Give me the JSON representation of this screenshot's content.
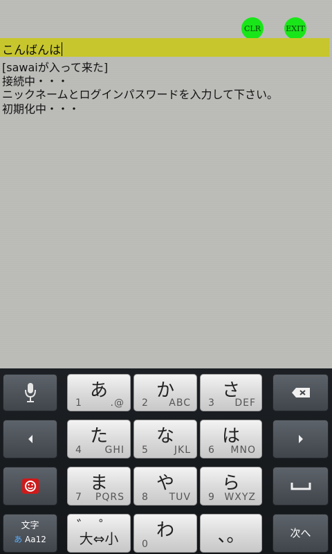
{
  "header": {
    "clr_label": "CLR",
    "exit_label": "EXIT"
  },
  "input": {
    "value": "こんばんは"
  },
  "messages": [
    "[sawaiが入って来た]",
    "接続中・・・",
    "ニックネームとログインパスワードを入力して下さい。",
    "初期化中・・・"
  ],
  "keyboard": {
    "row1": [
      {
        "kana": "あ",
        "num": "1",
        "alpha": ".@"
      },
      {
        "kana": "か",
        "num": "2",
        "alpha": "ABC"
      },
      {
        "kana": "さ",
        "num": "3",
        "alpha": "DEF"
      }
    ],
    "row2": [
      {
        "kana": "た",
        "num": "4",
        "alpha": "GHI"
      },
      {
        "kana": "な",
        "num": "5",
        "alpha": "JKL"
      },
      {
        "kana": "は",
        "num": "6",
        "alpha": "MNO"
      }
    ],
    "row3": [
      {
        "kana": "ま",
        "num": "7",
        "alpha": "PQRS"
      },
      {
        "kana": "や",
        "num": "8",
        "alpha": "TUV"
      },
      {
        "kana": "ら",
        "num": "9",
        "alpha": "WXYZ"
      }
    ],
    "row4": [
      {
        "label": "大⇔小",
        "top": "゛゜"
      },
      {
        "kana": "わ",
        "num": "0"
      },
      {
        "kana": "、。"
      }
    ],
    "mode_label": "文字",
    "mode_sub_a": "あ",
    "mode_sub_rest": "Aa12",
    "next_label": "次へ"
  },
  "colors": {
    "input_bar": "#c7c62d",
    "round_button": "#19e619",
    "chat_bg": "#bcbdb9"
  }
}
